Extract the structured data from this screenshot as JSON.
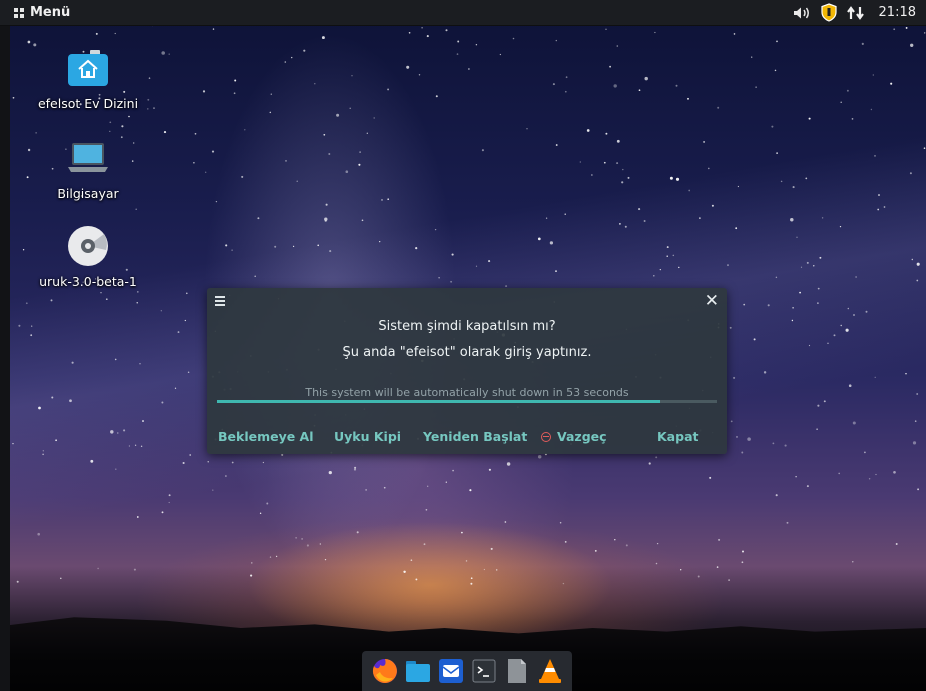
{
  "top_panel": {
    "menu_label": "Menü",
    "clock": "21:18",
    "tray_icons": [
      "volume-icon",
      "shield-icon",
      "network-icon"
    ]
  },
  "desktop": {
    "icons": [
      {
        "label": "efelsot Ev Dizini",
        "icon": "home-folder-icon"
      },
      {
        "label": "Bilgisayar",
        "icon": "computer-icon"
      },
      {
        "label": "uruk-3.0-beta-1",
        "icon": "disc-icon"
      }
    ]
  },
  "dialog": {
    "title": "Sistem şimdi kapatılsın mı?",
    "subtitle": "Şu anda \"efeisot\" olarak giriş yaptınız.",
    "countdown": "This system will be automatically shut down in 53 seconds",
    "progress_fraction": 0.885,
    "actions": {
      "suspend": "Beklemeye Al",
      "hibernate": "Uyku Kipi",
      "restart": "Yeniden Başlat",
      "cancel": "Vazgeç",
      "shutdown": "Kapat"
    }
  },
  "dock": {
    "items": [
      "firefox-icon",
      "files-icon",
      "mail-icon",
      "terminal-icon",
      "text-editor-icon",
      "vlc-icon"
    ]
  },
  "colors": {
    "accent": "#76c7c0",
    "progress": "#3fb8b0",
    "cancel_red": "#e05b5b",
    "panel": "#1b1d21"
  }
}
